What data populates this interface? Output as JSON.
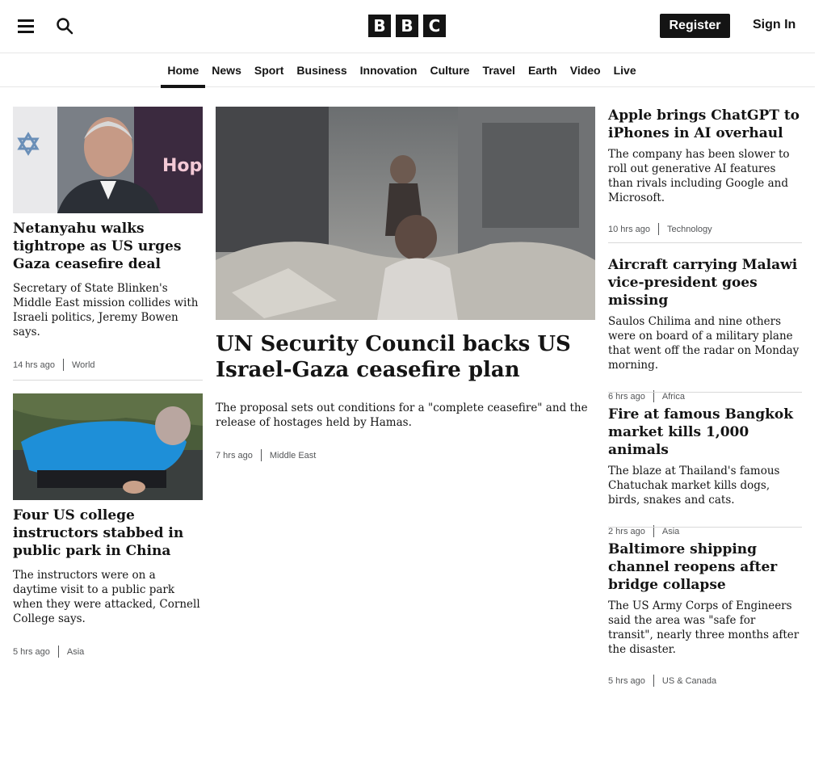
{
  "header": {
    "logo_letters": [
      "B",
      "B",
      "C"
    ],
    "register_label": "Register",
    "signin_label": "Sign In",
    "menu_icon": "hamburger-menu-icon",
    "search_icon": "search-icon"
  },
  "nav": {
    "items": [
      "Home",
      "News",
      "Sport",
      "Business",
      "Innovation",
      "Culture",
      "Travel",
      "Earth",
      "Video",
      "Live"
    ],
    "active": "Home"
  },
  "left": {
    "stories": [
      {
        "headline": "Netanyahu walks tightrope as US urges Gaza ceasefire deal",
        "summary": "Secretary of State Blinken's Middle East mission collides with Israeli politics, Jeremy Bowen says.",
        "time": "14 hrs ago",
        "section": "World"
      },
      {
        "headline": "Four US college instructors stabbed in public park in China",
        "summary": "The instructors were on a daytime visit to a public park when they were attacked, Cornell College says.",
        "time": "5 hrs ago",
        "section": "Asia"
      }
    ]
  },
  "center": {
    "headline": "UN Security Council backs US Israel-Gaza ceasefire plan",
    "summary": "The proposal sets out conditions for a \"complete ceasefire\" and the release of hostages held by Hamas.",
    "time": "7 hrs ago",
    "section": "Middle East"
  },
  "right": {
    "stories": [
      {
        "headline": "Apple brings ChatGPT to iPhones in AI overhaul",
        "summary": "The company has been slower to roll out generative AI features than rivals including Google and Microsoft.",
        "time": "10 hrs ago",
        "section": "Technology"
      },
      {
        "headline": "Aircraft carrying Malawi vice-president goes missing",
        "summary": "Saulos Chilima and nine others were on board of a military plane that went off the radar on Monday morning.",
        "time": "6 hrs ago",
        "section": "Africa"
      },
      {
        "headline": "Fire at famous Bangkok market kills 1,000 animals",
        "summary": "The blaze at Thailand's famous Chatuchak market kills dogs, birds, snakes and cats.",
        "time": "2 hrs ago",
        "section": "Asia"
      },
      {
        "headline": "Baltimore shipping channel reopens after bridge collapse",
        "summary": "The US Army Corps of Engineers said the area was \"safe for transit\", nearly three months after the disaster.",
        "time": "5 hrs ago",
        "section": "US & Canada"
      }
    ]
  },
  "colors": {
    "text": "#141414",
    "meta": "#545658",
    "divider": "#d9d9d9"
  }
}
